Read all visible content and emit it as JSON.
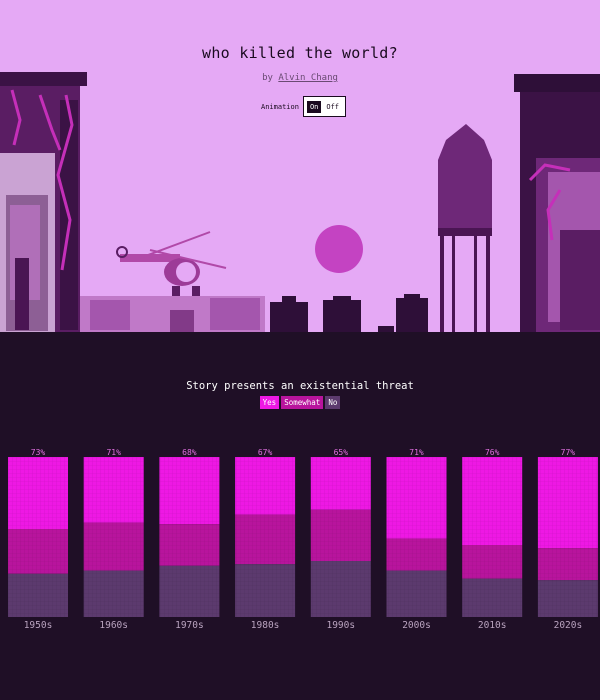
{
  "header": {
    "title": "who killed the world?",
    "byline_prefix": "by",
    "author": "Alvin Chang",
    "animation_label": "Animation",
    "toggle_on": "On",
    "toggle_off": "Off"
  },
  "colors": {
    "sky": "#e5a9f5",
    "dark": "#1f0f26",
    "yes": "#ee18e4",
    "somewhat": "#b8149d",
    "no": "#5c3a6e",
    "sun": "#c443c2"
  },
  "chart_data": {
    "type": "bar",
    "title": "Story presents an existential threat",
    "legend": [
      "Yes",
      "Somewhat",
      "No"
    ],
    "stacked": true,
    "categories": [
      "1950s",
      "1960s",
      "1970s",
      "1980s",
      "1990s",
      "2000s",
      "2010s",
      "2020s"
    ],
    "total_labels": [
      "73%",
      "71%",
      "68%",
      "67%",
      "65%",
      "71%",
      "76%",
      "77%"
    ],
    "series": [
      {
        "name": "Yes",
        "values": [
          0.45,
          0.41,
          0.42,
          0.36,
          0.33,
          0.51,
          0.55,
          0.57
        ]
      },
      {
        "name": "Somewhat",
        "values": [
          0.28,
          0.3,
          0.26,
          0.31,
          0.32,
          0.2,
          0.21,
          0.2
        ]
      },
      {
        "name": "No",
        "values": [
          0.27,
          0.29,
          0.32,
          0.33,
          0.35,
          0.29,
          0.24,
          0.23
        ]
      }
    ],
    "ylim": [
      0,
      1
    ]
  }
}
